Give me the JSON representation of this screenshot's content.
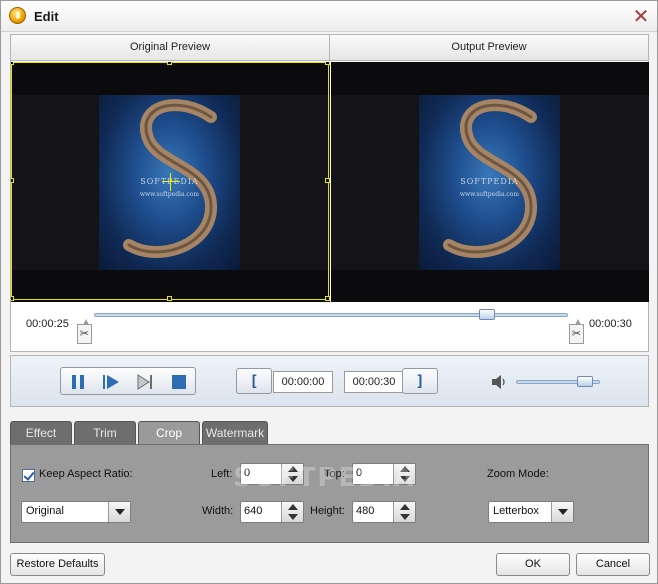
{
  "window": {
    "title": "Edit",
    "close_glyph": "✕"
  },
  "preview": {
    "original_label": "Original Preview",
    "output_label": "Output Preview",
    "image_caption": "SOFTPEDIA",
    "image_subcaption": "www.softpedia.com"
  },
  "timeline": {
    "start_time": "00:00:25",
    "end_time": "00:00:30",
    "position_fraction": 0.84
  },
  "playback": {
    "icons": [
      "pause-icon",
      "play-icon",
      "next-frame-icon",
      "stop-icon"
    ],
    "mark_start_label": "[",
    "start_value": "00:00:00",
    "end_value": "00:00:30",
    "mark_end_label": "]",
    "volume_fraction": 0.9
  },
  "tabs": [
    {
      "label": "Effect",
      "active": false
    },
    {
      "label": "Trim",
      "active": false
    },
    {
      "label": "Crop",
      "active": true
    },
    {
      "label": "Watermark",
      "active": false
    }
  ],
  "crop": {
    "keep_aspect_label": "Keep Aspect Ratio:",
    "keep_aspect_checked": true,
    "aspect_value": "Original",
    "left_label": "Left:",
    "left_value": "0",
    "top_label": "Top:",
    "top_value": "0",
    "width_label": "Width:",
    "width_value": "640",
    "height_label": "Height:",
    "height_value": "480",
    "zoom_mode_label": "Zoom Mode:",
    "zoom_mode_value": "Letterbox",
    "watermark_text": "SOFTPEDIA"
  },
  "buttons": {
    "restore": "Restore Defaults",
    "ok": "OK",
    "cancel": "Cancel"
  },
  "colors": {
    "accent": "#2c5c94",
    "crop_frame": "#e6e600",
    "panel_bg": "#9b9b9b",
    "close": "#a53b3b"
  }
}
